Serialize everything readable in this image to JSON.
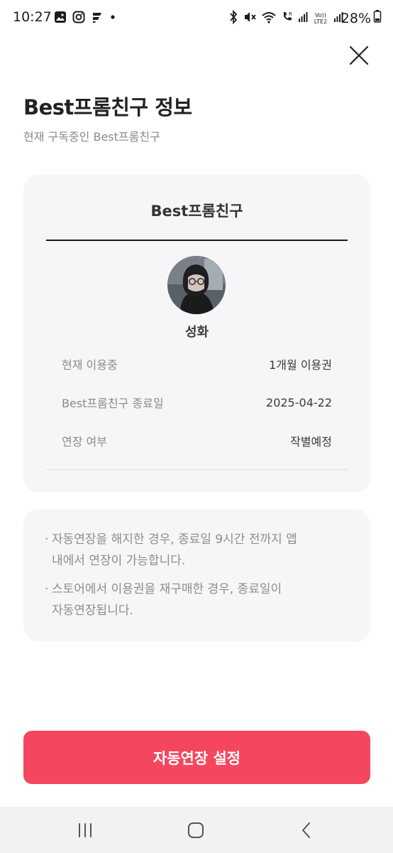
{
  "status_bar": {
    "time": "10:27",
    "battery": "28%",
    "left_icons": [
      "gallery-icon",
      "instagram-icon",
      "app-icon",
      "dot-icon"
    ],
    "right_icons": [
      "bluetooth-icon",
      "mute-icon",
      "wifi-icon",
      "call-icon",
      "signal-icon",
      "volte-icon",
      "signal-icon"
    ],
    "volte_text": "Vo)) LTE2",
    "r_text": "R"
  },
  "page": {
    "title": "Best프롬친구 정보",
    "subtitle": "현재 구독중인 Best프롬친구"
  },
  "card": {
    "title": "Best프롬친구",
    "user_name": "성화",
    "rows": [
      {
        "label": "현재 이용중",
        "value": "1개월 이용권"
      },
      {
        "label": "Best프롬친구 종료일",
        "value": "2025-04-22"
      },
      {
        "label": "연장 여부",
        "value": "작별예정"
      }
    ]
  },
  "notice": {
    "bullet": "·",
    "items": [
      {
        "line1": "자동연장을 해지한 경우, 종료일 9시간 전까지 앱",
        "line2": "내에서 연장이 가능합니다."
      },
      {
        "line1": "스토어에서 이용권을 재구매한 경우, 종료일이",
        "line2": "자동연장됩니다."
      }
    ]
  },
  "cta": {
    "label": "자동연장 설정"
  },
  "colors": {
    "accent": "#f4475f",
    "card_bg": "#f6f6f8",
    "navbar_bg": "#f2f2f4"
  }
}
